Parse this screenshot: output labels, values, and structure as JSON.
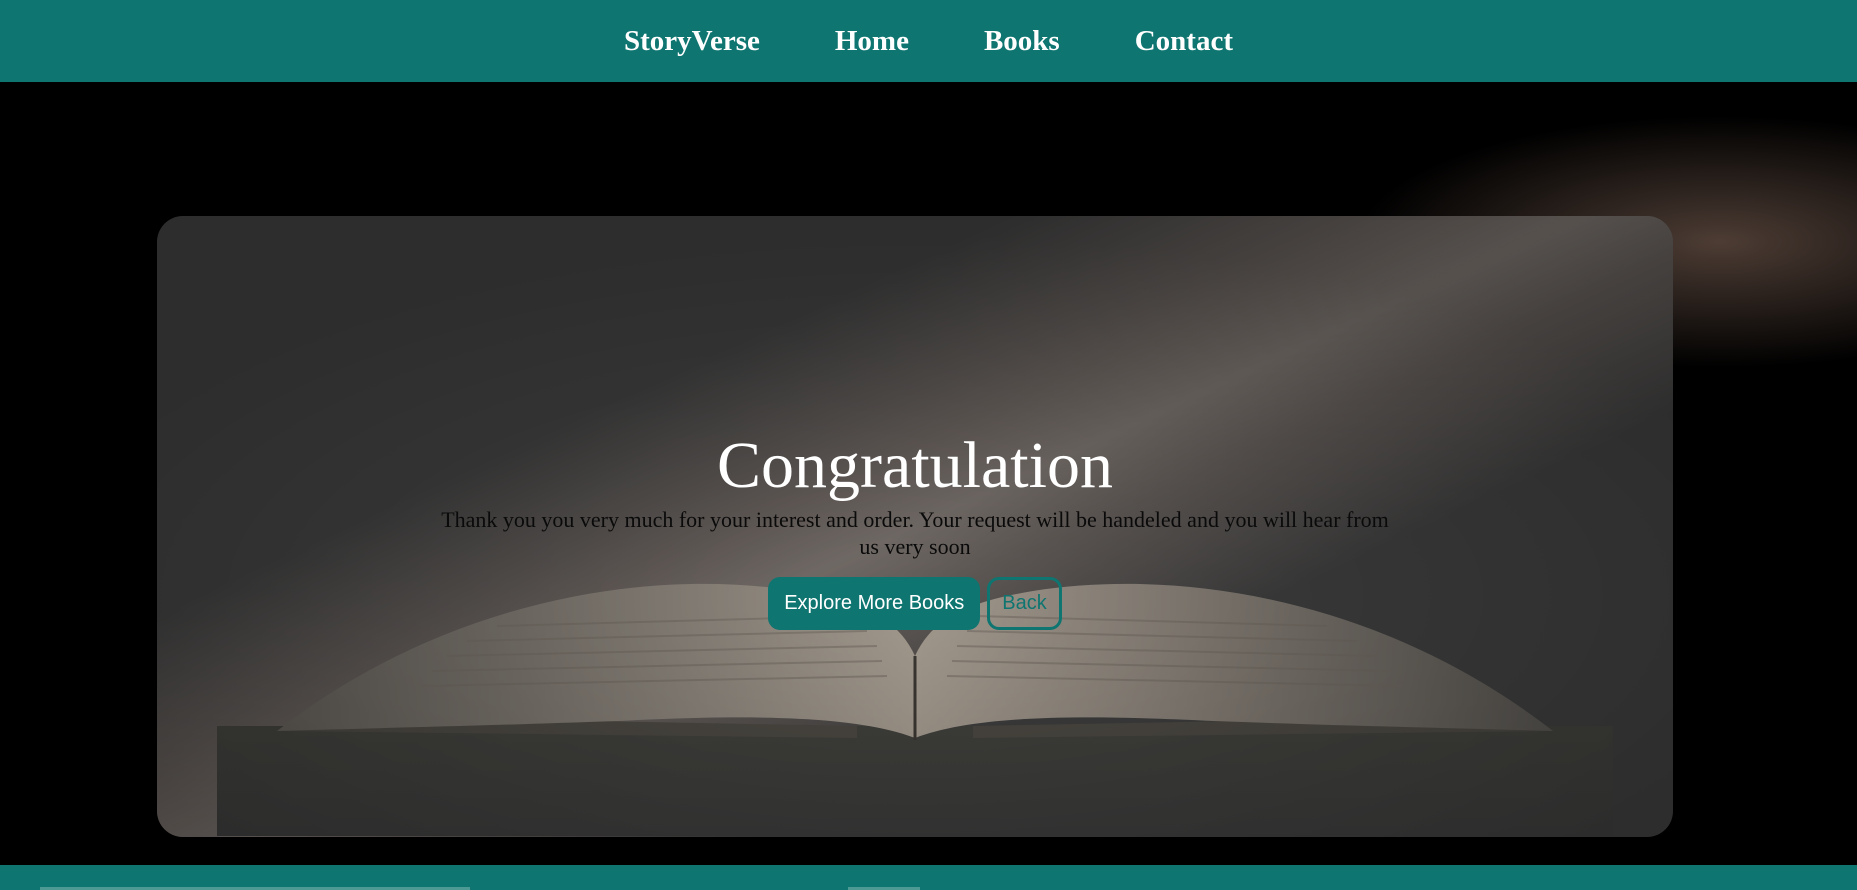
{
  "nav": {
    "brand": "StoryVerse",
    "links": [
      "Home",
      "Books",
      "Contact"
    ]
  },
  "hero": {
    "heading": "Congratulation",
    "message": "Thank you you very much for your interest and order. Your request will be handeled and you will hear from us very soon",
    "primary_button": "Explore More Books",
    "secondary_button": "Back"
  },
  "colors": {
    "accent": "#0f7570",
    "card": "#3c3c3c",
    "background": "#000000"
  }
}
